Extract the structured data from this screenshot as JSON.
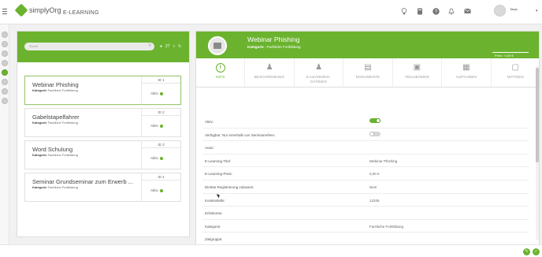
{
  "app": {
    "brand": "simplyOrg",
    "section_title": "E-LEARNING"
  },
  "user": {
    "name": "Tanja"
  },
  "search": {
    "placeholder": "Suche"
  },
  "list_tools": {
    "count": "27"
  },
  "courses": [
    {
      "title": "Webinar Phishing",
      "category_label": "Kategorie",
      "category": "Fachliche Fortbildung",
      "id": "ID 1",
      "status": "Aktiv"
    },
    {
      "title": "Gabelstapelfahrer",
      "category_label": "Kategorie",
      "category": "Fachliche Fortbildung",
      "id": "ID 2",
      "status": "Aktiv"
    },
    {
      "title": "Word Schulung",
      "category_label": "Kategorie",
      "category": "Fachliche Fortbildung",
      "id": "ID 3",
      "status": "Aktiv"
    },
    {
      "title": "Seminar Grundseminar zum Erwerb ...",
      "category_label": "Kategorie",
      "category": "Fachliche Fortbildung",
      "id": "ID 4",
      "status": "Aktiv"
    }
  ],
  "detail": {
    "title": "Webinar Phishing",
    "category_label": "Kategorie",
    "category": "Fachliche Fortbildung",
    "price": "Preis : 0,00 €"
  },
  "tabs": [
    {
      "label": "INFO",
      "icon": "info-icon"
    },
    {
      "label": "BESCHREIBUNG",
      "icon": "person-icon"
    },
    {
      "label": "E-LEARNING-DATEIEN",
      "icon": "user-file-icon"
    },
    {
      "label": "DOKUMENTE",
      "icon": "documents-icon"
    },
    {
      "label": "TEILNEHMER",
      "icon": "participants-icon"
    },
    {
      "label": "AUFGABEN",
      "icon": "calendar-icon"
    },
    {
      "label": "NOTIZEN",
      "icon": "notes-icon"
    }
  ],
  "info_rows": [
    {
      "label": "Aktiv: ",
      "value": ""
    },
    {
      "label": "Verfügbar: Nur innerhalb von Seminarreihen: ",
      "value": ""
    },
    {
      "label": "Autor:",
      "value": ""
    },
    {
      "label": "E-Learning-Titel:",
      "value": "Webinar Phishing"
    },
    {
      "label": "E-Learning-Preis:",
      "value": "0,00 €"
    },
    {
      "label": "Direkte Registrierung zulassen:",
      "value": "Nein"
    },
    {
      "label": "Kostenstelle:",
      "value": "12345"
    },
    {
      "label": "Erlöskonto:",
      "value": ""
    },
    {
      "label": "Kategorie:",
      "value": "Fachliche Fortbildung"
    },
    {
      "label": "Zielgruppe:",
      "value": ""
    }
  ],
  "toggles": {
    "aktiv": true,
    "verfuegbar": false
  },
  "colors": {
    "accent": "#6bb32e"
  }
}
